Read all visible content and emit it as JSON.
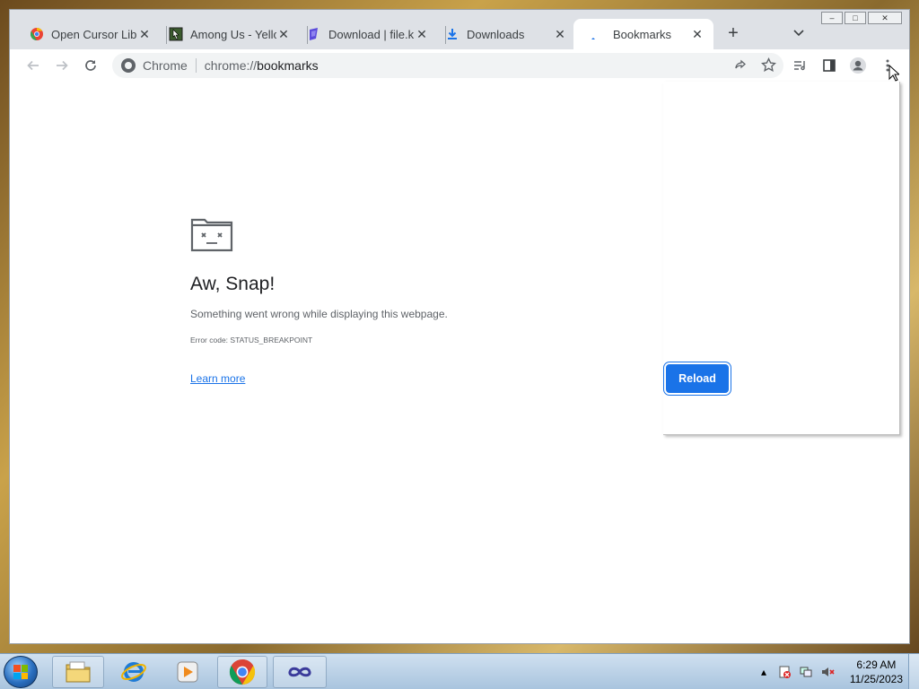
{
  "window": {
    "controls": {
      "minimize": "–",
      "maximize": "□",
      "close": "✕"
    }
  },
  "tabs": [
    {
      "title": "Open Cursor Libr",
      "icon": "chrome-web-store-icon",
      "close": "✕",
      "active": false
    },
    {
      "title": "Among Us - Yello",
      "icon": "cursor-page-icon",
      "close": "✕",
      "active": false
    },
    {
      "title": "Download | file.k",
      "icon": "file-download-site-icon",
      "close": "✕",
      "active": false
    },
    {
      "title": "Downloads",
      "icon": "download-icon",
      "close": "✕",
      "active": false
    },
    {
      "title": "Bookmarks",
      "icon": "loading-icon",
      "close": "✕",
      "active": true
    }
  ],
  "new_tab": "+",
  "tab_search": "⌄",
  "toolbar": {
    "back": "←",
    "forward": "→",
    "reload": "↻",
    "omnibox_chip": "Chrome",
    "url_scheme": "chrome://",
    "url_host": "bookmarks",
    "share": "⇧",
    "bookmark_star": "☆",
    "reading_list": "≡",
    "side_panel": "▧",
    "profile": "●",
    "menu": "⋮"
  },
  "error_page": {
    "title": "Aw, Snap!",
    "message": "Something went wrong while displaying this webpage.",
    "error_code": "Error code: STATUS_BREAKPOINT",
    "learn_more": "Learn more",
    "reload_button": "Reload"
  },
  "taskbar": {
    "apps": [
      "file-explorer-icon",
      "internet-explorer-icon",
      "media-player-icon",
      "chrome-icon",
      "app-infinity-icon"
    ],
    "tray_expand": "▴",
    "clock_time": "6:29 AM",
    "clock_date": "11/25/2023"
  },
  "colors": {
    "accent": "#1a73e8",
    "tabstrip": "#dee1e6",
    "page_bg": "#ffffff"
  }
}
